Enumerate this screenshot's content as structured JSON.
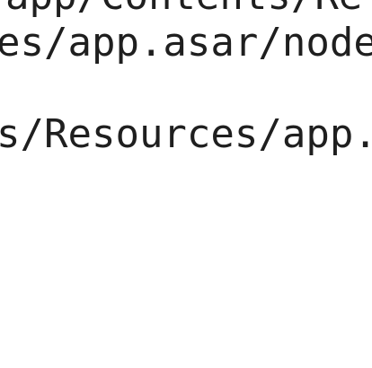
{
  "lines": [
    "app/Contents/Re",
    "es/app.asar/node",
    "s/Resources/app."
  ]
}
